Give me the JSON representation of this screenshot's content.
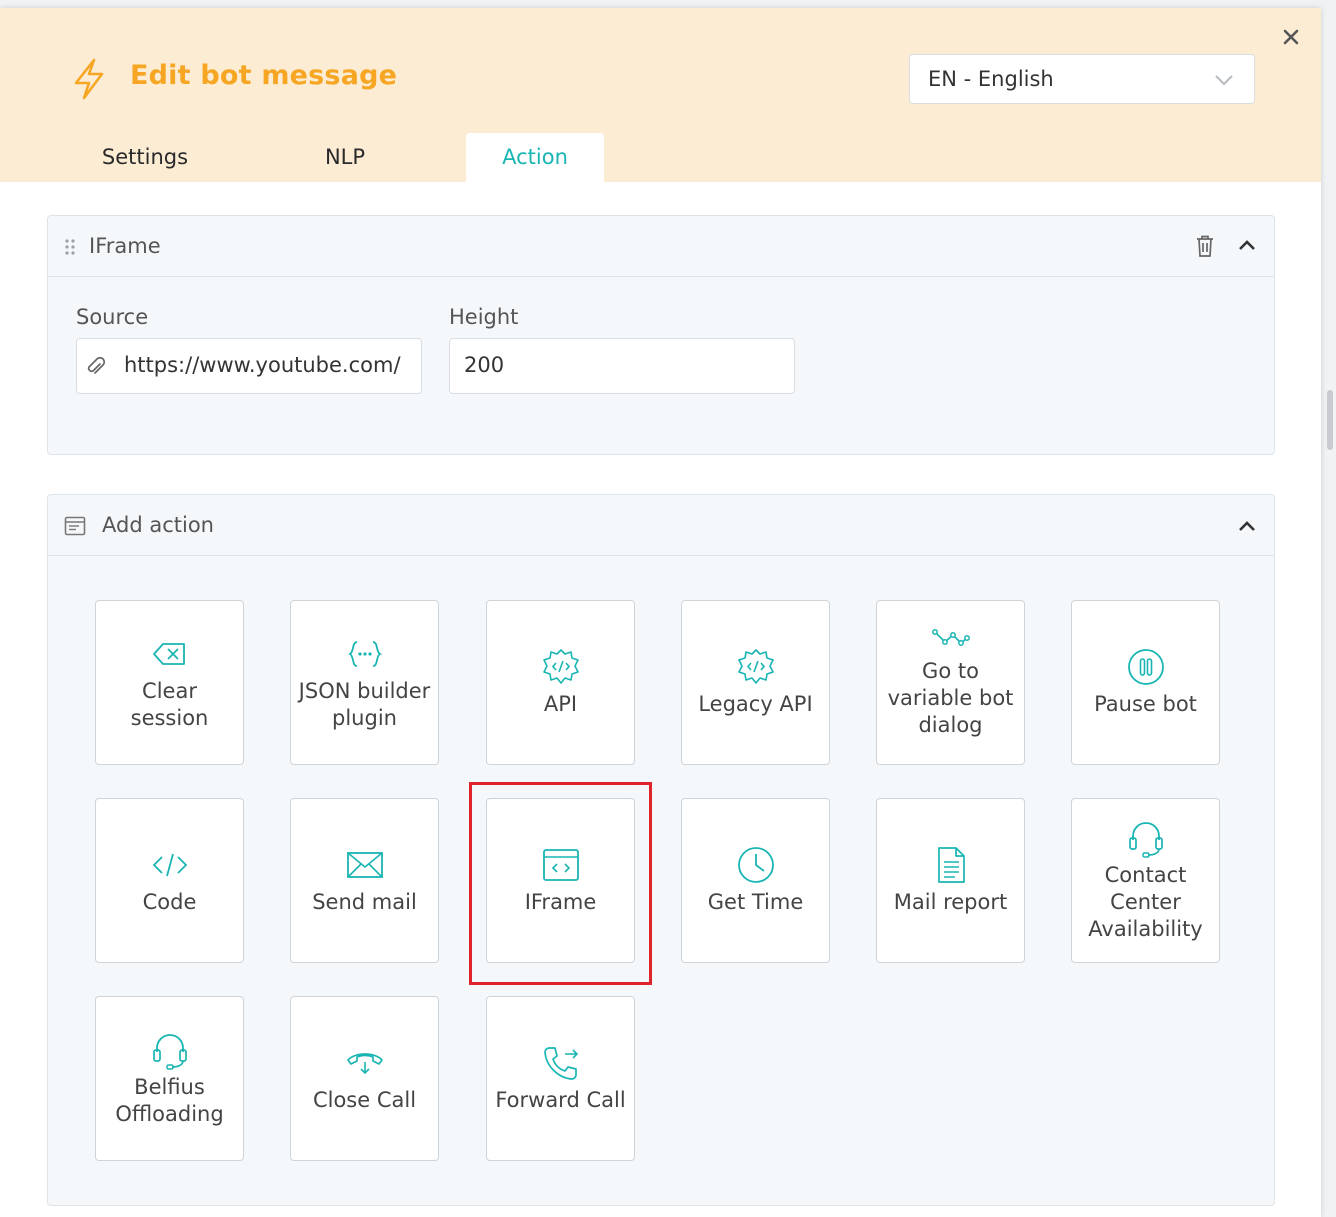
{
  "header": {
    "title": "Edit bot message",
    "language": "EN - English"
  },
  "tabs": [
    {
      "label": "Settings"
    },
    {
      "label": "NLP"
    },
    {
      "label": "Action"
    }
  ],
  "iframe_panel": {
    "title": "IFrame",
    "source_label": "Source",
    "source_value": "https://www.youtube.com/",
    "height_label": "Height",
    "height_value": "200"
  },
  "add_action": {
    "title": "Add action",
    "actions": [
      {
        "label": "Clear session"
      },
      {
        "label": "JSON builder plugin"
      },
      {
        "label": "API"
      },
      {
        "label": "Legacy API"
      },
      {
        "label": "Go to variable bot dialog"
      },
      {
        "label": "Pause bot"
      },
      {
        "label": "Code"
      },
      {
        "label": "Send mail"
      },
      {
        "label": "IFrame"
      },
      {
        "label": "Get Time"
      },
      {
        "label": "Mail report"
      },
      {
        "label": "Contact Center Availability"
      },
      {
        "label": "Belfius Offloading"
      },
      {
        "label": "Close Call"
      },
      {
        "label": "Forward Call"
      }
    ]
  },
  "colors": {
    "accent": "#19b5b3",
    "title": "#f6a623",
    "header_bg": "#fcecd4",
    "highlight": "#e0242b"
  }
}
